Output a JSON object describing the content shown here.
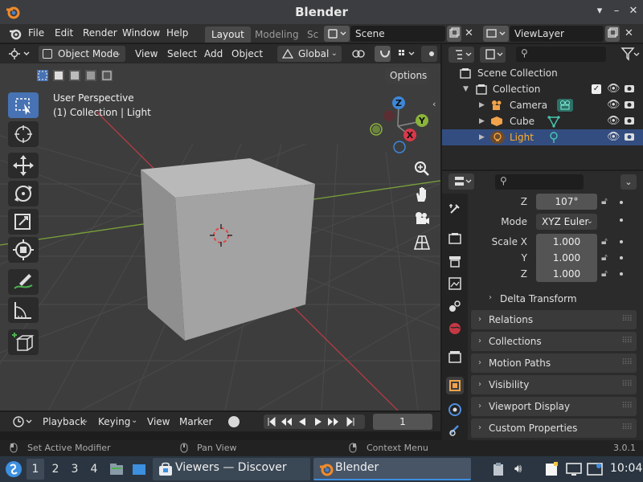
{
  "window": {
    "title": "Blender"
  },
  "menubar": {
    "items": [
      "File",
      "Edit",
      "Render",
      "Window",
      "Help"
    ],
    "workspace_tabs": [
      "Layout",
      "Modeling",
      "Sc"
    ],
    "scene": "Scene",
    "view_layer": "ViewLayer"
  },
  "viewport_header": {
    "mode": "Object Mode",
    "menus": [
      "View",
      "Select",
      "Add",
      "Object"
    ],
    "orientation": "Global",
    "options_label": "Options"
  },
  "viewport": {
    "perspective": "User Perspective",
    "context": "(1) Collection | Light",
    "gizmo_axes": [
      "Z",
      "Y",
      "X"
    ],
    "tools": [
      "select-box",
      "cursor",
      "move",
      "rotate",
      "scale",
      "transform",
      "annotate",
      "measure",
      "add-cube"
    ]
  },
  "timeline": {
    "playback": "Playback",
    "keying": "Keying",
    "view": "View",
    "marker": "Marker",
    "current_frame": "1"
  },
  "outliner": {
    "root": "Scene Collection",
    "collection": "Collection",
    "objects": [
      {
        "name": "Camera",
        "type": "camera",
        "color": "#f0a34a"
      },
      {
        "name": "Cube",
        "type": "mesh",
        "color": "#f0a34a"
      },
      {
        "name": "Light",
        "type": "light",
        "color": "#f0a34a"
      }
    ],
    "selected": "Light"
  },
  "properties": {
    "rotation_z_label": "Z",
    "rotation_z": "107°",
    "mode_label": "Mode",
    "mode": "XYZ Euler",
    "scale_x_label": "Scale X",
    "scale_y_label": "Y",
    "scale_z_label": "Z",
    "scale_x": "1.000",
    "scale_y": "1.000",
    "scale_z": "1.000",
    "delta_transform": "Delta Transform",
    "panels": [
      "Relations",
      "Collections",
      "Motion Paths",
      "Visibility",
      "Viewport Display",
      "Custom Properties"
    ]
  },
  "statusbar": {
    "left": "Set Active Modifier",
    "middle": "Pan View",
    "right": "Context Menu",
    "version": "3.0.1"
  },
  "taskbar": {
    "desktops": [
      "1",
      "2",
      "3",
      "4"
    ],
    "tasks": [
      "Viewers — Discover",
      "Blender"
    ],
    "clock": "10:04"
  },
  "colors": {
    "accent": "#4772b3",
    "selection": "#334d80",
    "selected_text": "#ffaf29",
    "axis_x": "#d9394b",
    "axis_y": "#8bb43a",
    "axis_z": "#3d87d8"
  }
}
